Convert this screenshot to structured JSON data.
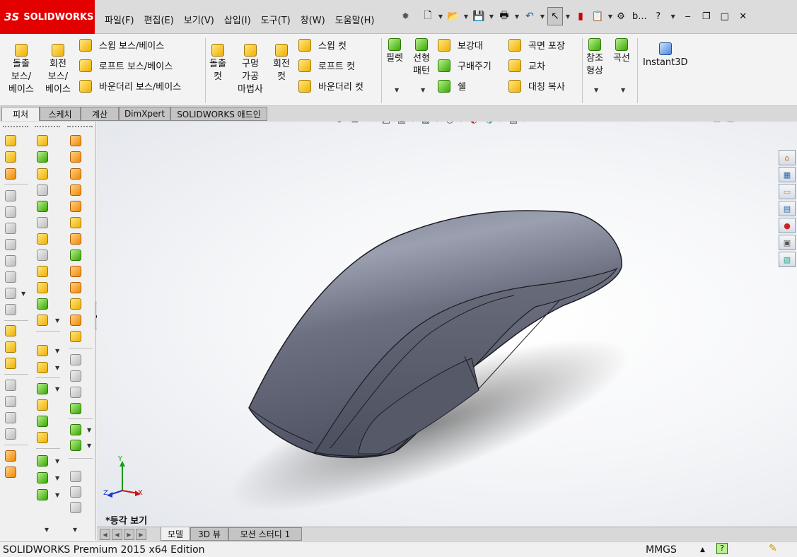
{
  "app": {
    "logo_text": "SOLIDWORKS",
    "logo_mark": "3S"
  },
  "menu": [
    "파일(F)",
    "편집(E)",
    "보기(V)",
    "삽입(I)",
    "도구(T)",
    "창(W)",
    "도움말(H)"
  ],
  "quick_icons": [
    "new-document-icon",
    "open-folder-icon",
    "save-icon",
    "print-icon",
    "undo-icon",
    "select-cursor-icon",
    "rebuild-traffic-light-icon",
    "file-properties-icon"
  ],
  "window": {
    "search_text": "b...",
    "help_glyph": "?"
  },
  "commands": {
    "extrude_boss": [
      "돌출",
      "보스/",
      "베이스"
    ],
    "revolve_boss": [
      "회전",
      "보스/",
      "베이스"
    ],
    "swept_boss": "스윕 보스/베이스",
    "loft_boss": "로프트 보스/베이스",
    "boundary_boss": "바운더리 보스/베이스",
    "extrude_cut": [
      "돌출",
      "컷"
    ],
    "hole_wizard": [
      "구멍",
      "가공",
      "마법사"
    ],
    "revolve_cut": [
      "회전",
      "컷"
    ],
    "swept_cut": "스윕 컷",
    "loft_cut": "로프트 컷",
    "boundary_cut": "바운더리 컷",
    "fillet": "필렛",
    "linear_pattern": [
      "선형",
      "패턴"
    ],
    "rib": "보강대",
    "draft": "구배주기",
    "shell": "쉘",
    "wrap": "곡면 포장",
    "intersect": "교차",
    "mirror": "대칭 복사",
    "reference_geometry": [
      "참조",
      "형상"
    ],
    "curves": "곡선",
    "instant3d": "Instant3D"
  },
  "tabs": [
    "피처",
    "스케치",
    "계산",
    "DimXpert",
    "SOLIDWORKS 애드인"
  ],
  "viewport": {
    "view_name": "*등각 보기",
    "triad": {
      "x": "X",
      "y": "Y",
      "z": "Z"
    },
    "model_color": "#5c6070",
    "hud_icons": [
      "zoom-to-fit-icon",
      "zoom-area-icon",
      "previous-view-icon",
      "section-view-icon",
      "view-orientation-icon",
      "display-style-icon",
      "hide-show-items-icon",
      "edit-appearance-icon",
      "apply-scene-icon",
      "view-settings-icon"
    ]
  },
  "bottom_tabs": [
    "모델",
    "3D 뷰",
    "모션 스터디 1"
  ],
  "status": {
    "edition": "SOLIDWORKS Premium 2015 x64 Edition",
    "units": "MMGS",
    "units_arrow": "▲",
    "help_glyph": "?"
  },
  "colors": {
    "brand_red": "#e30000",
    "accent_yellow": "#f0b000"
  }
}
